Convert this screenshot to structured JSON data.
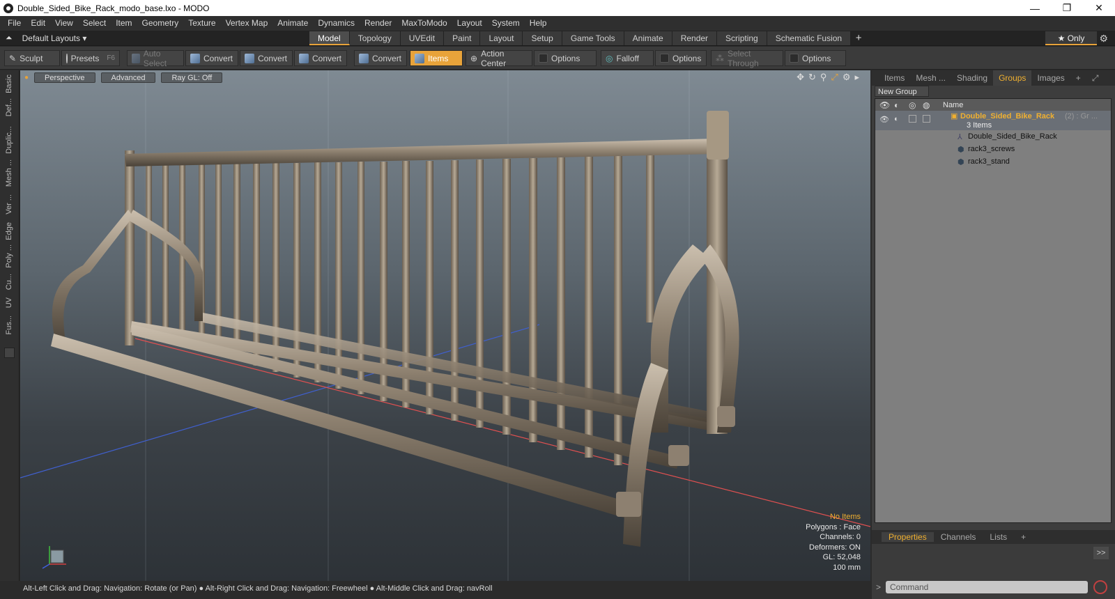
{
  "window": {
    "title": "Double_Sided_Bike_Rack_modo_base.lxo - MODO",
    "minimize": "—",
    "maximize": "❐",
    "close": "✕"
  },
  "menu": [
    "File",
    "Edit",
    "View",
    "Select",
    "Item",
    "Geometry",
    "Texture",
    "Vertex Map",
    "Animate",
    "Dynamics",
    "Render",
    "MaxToModo",
    "Layout",
    "System",
    "Help"
  ],
  "layoutbar": {
    "layouts_label": "Default Layouts ▾",
    "only_label": "★  Only"
  },
  "layout_tabs": [
    {
      "label": "Model",
      "active": true
    },
    {
      "label": "Topology"
    },
    {
      "label": "UVEdit"
    },
    {
      "label": "Paint"
    },
    {
      "label": "Layout"
    },
    {
      "label": "Setup"
    },
    {
      "label": "Game Tools"
    },
    {
      "label": "Animate"
    },
    {
      "label": "Render"
    },
    {
      "label": "Scripting"
    },
    {
      "label": "Schematic Fusion"
    }
  ],
  "toolbar": {
    "sculpt": "Sculpt",
    "presets": "Presets",
    "presets_key": "F6",
    "auto_select": "Auto Select",
    "convert": "Convert",
    "items": "Items",
    "action_center": "Action Center",
    "options": "Options",
    "falloff": "Falloff",
    "select_through": "Select Through"
  },
  "left_tabs": [
    "Basic",
    "Def...",
    "Duplic...",
    "Mesh ...",
    "Ver ...",
    "Edge",
    "Poly ...",
    "Cu...",
    "UV",
    "Fus..."
  ],
  "viewport": {
    "perspective": "Perspective",
    "advanced": "Advanced",
    "raygl": "Ray GL: Off",
    "stats": {
      "no_items": "No Items",
      "polygons": "Polygons : Face",
      "channels": "Channels: 0",
      "deformers": "Deformers: ON",
      "gl": "GL: 52,048",
      "scale": "100 mm"
    }
  },
  "status": "Alt-Left Click and Drag: Navigation: Rotate (or Pan) ● Alt-Right Click and Drag: Navigation: Freewheel ● Alt-Middle Click and Drag: navRoll",
  "right_panel": {
    "tabs": [
      {
        "label": "Items"
      },
      {
        "label": "Mesh ..."
      },
      {
        "label": "Shading"
      },
      {
        "label": "Groups",
        "active": true
      },
      {
        "label": "Images"
      }
    ],
    "new_group": "New Group",
    "col_name": "Name",
    "group": {
      "name": "Double_Sided_Bike_Rack",
      "suffix": "(2) : Gr ...",
      "count": "3 Items"
    },
    "children": [
      "Double_Sided_Bike_Rack",
      "rack3_screws",
      "rack3_stand"
    ]
  },
  "bottom_panel": {
    "tabs": [
      {
        "label": "Properties",
        "active": true
      },
      {
        "label": "Channels"
      },
      {
        "label": "Lists"
      }
    ],
    "command_placeholder": "Command",
    "expand": ">>"
  },
  "colors": {
    "accent": "#e8a33a",
    "group_label": "#f0b030",
    "axis_red": "#e05050",
    "axis_blue": "#4060d0"
  }
}
